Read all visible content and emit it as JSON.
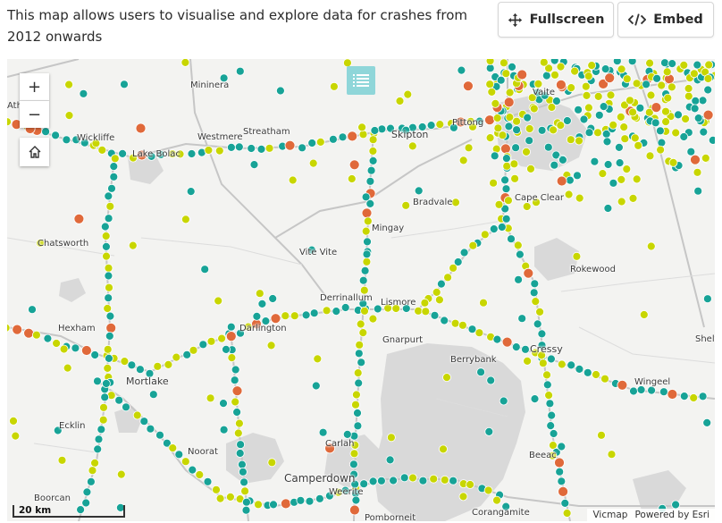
{
  "description": "This map allows users to visualise and explore data for crashes from 2012 onwards",
  "buttons": {
    "fullscreen_label": "Fullscreen",
    "embed_label": "Embed"
  },
  "map_controls": {
    "zoom_in": "+",
    "zoom_out": "−",
    "home_icon": "home-icon",
    "legend_icon": "list-icon"
  },
  "place_names": {
    "minninera": "Mininera",
    "streatham": "Streatham",
    "westmere": "Westmere",
    "wickliffe": "Wickliffe",
    "lake_bolac": "Lake Bolac",
    "skipton": "Skipton",
    "pitfield": "Pittong",
    "bradvale": "Bradvale",
    "mingay": "Mingay",
    "chatsworth": "Chatsworth",
    "vite_vite": "Vite Vite",
    "derrinallum": "Derrinallum",
    "lismore": "Lismore",
    "rokewood": "Rokewood",
    "cape_clear": "Cape Clear",
    "hexham": "Hexham",
    "darlington": "Darlington",
    "gnarpurt": "Gnarpurt",
    "cressy": "Cressy",
    "mortlake": "Mortlake",
    "wingeel": "Wingeel",
    "terrinallum": "Berrybank",
    "ecklin": "Ecklin",
    "pomborneit": "Pomborneit",
    "camperdown": "Camperdown",
    "weerite": "Weerite",
    "beeac": "Beeac",
    "corangamite": "Corangamite",
    "boorcan": "Boorcan",
    "vitality": "Vaite",
    "athol": "Athol",
    "shelford": "Shelford",
    "noorat": "Noorat",
    "darlinton": "Darlington",
    "carlah": "Carlah"
  },
  "scale_label": "20 km",
  "attribution": {
    "source": "Vicmap",
    "powered_by": "Powered by Esri"
  },
  "colors": {
    "map_bg": "#f3f3f1",
    "lake": "#d6d6d6",
    "road": "#c9c9c9",
    "legend_btn": "#8fd6d9",
    "crash_teal": "#17a397",
    "crash_lime": "#c8d600",
    "crash_orange": "#e0693a"
  }
}
